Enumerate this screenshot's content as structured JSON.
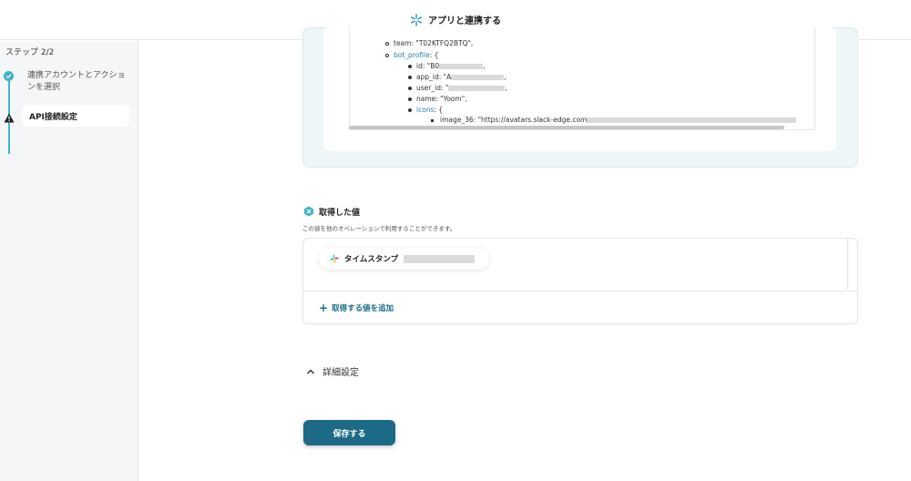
{
  "header": {
    "title": "アプリと連携する",
    "logo_icon": "yoom-link-icon"
  },
  "sidebar": {
    "step_label": "ステップ 2/2",
    "steps": [
      {
        "label": "連携アカウントとアクションを選択",
        "status": "complete",
        "icon": "check-circle-icon"
      },
      {
        "label": "API接続設定",
        "status": "warning",
        "icon": "warning-triangle-icon"
      }
    ],
    "accent_color": "#3fb6c8"
  },
  "response": {
    "lines": {
      "team": "team: \"T02KTFQ2BTQ\",",
      "bot_profile_key": "bot_profile",
      "bot_profile_suffix": ": {",
      "id": "id: \"B0",
      "app_id": "app_id: \"A",
      "user_id": "user_id: \"",
      "name": "name: \"Yoom\",",
      "icons_key": "icons",
      "icons_suffix": ": {",
      "image_36": "image_36: \"https://avatars.slack-edge.com"
    }
  },
  "acquired": {
    "title": "取得した値",
    "description": "この値を他のオペレーションで利用することができます。",
    "chip_label": "タイムスタンプ",
    "chip_icon": "slack-icon",
    "add_label": "取得する値を追加"
  },
  "detail": {
    "label": "詳細設定",
    "icon": "chevron-up-icon"
  },
  "save": {
    "label": "保存する",
    "color": "#1c6a85"
  }
}
